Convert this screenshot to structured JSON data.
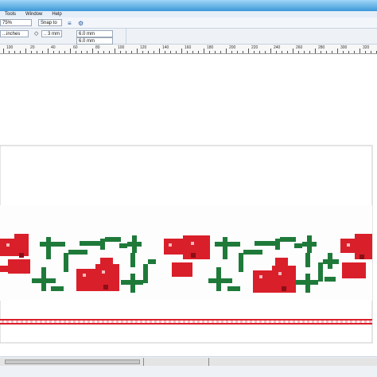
{
  "menu": {
    "items": [
      {
        "label": "Tools"
      },
      {
        "label": "Window"
      },
      {
        "label": "Help"
      }
    ]
  },
  "propertybar": {
    "zoom_value": "75%",
    "snap_value": "Snap to",
    "units_value": "...inches",
    "outline_value": ".. 3 mm",
    "nudge_value": "",
    "dup_x_value": "6.0 mm",
    "dup_y_value": "6.0 mm"
  },
  "ruler": {
    "labels": [
      "100",
      "0",
      "20",
      "40",
      "60",
      "80",
      "100",
      "120",
      "140",
      "160",
      "180",
      "200",
      "220",
      "240",
      "260",
      "280",
      "300",
      "320"
    ]
  },
  "colors": {
    "red": "#d91f2a",
    "dark_red": "#8a0f17",
    "green": "#1f7a3a",
    "light_pink": "#f4b8bc",
    "toolbar_bg": "#f2f5fa",
    "title_gradient": "#3c98d8"
  },
  "icons": [
    "new-page-icon",
    "select-icon",
    "zoom-icon",
    "grid-icon",
    "snap-icon",
    "options-icon"
  ]
}
